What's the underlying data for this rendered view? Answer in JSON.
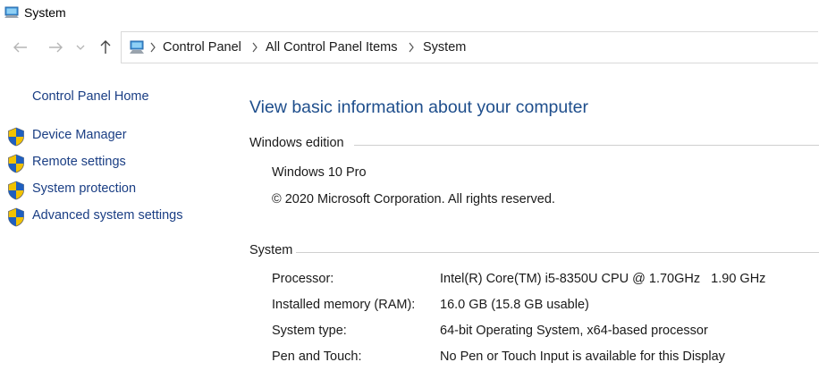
{
  "window": {
    "title": "System"
  },
  "nav": {
    "back": "back-arrow",
    "forward": "forward-arrow",
    "recent": "chevron-down",
    "up": "up-arrow"
  },
  "address": {
    "crumbs": [
      "Control Panel",
      "All Control Panel Items",
      "System"
    ]
  },
  "sidebar": {
    "home_label": "Control Panel Home",
    "tasks": [
      {
        "label": "Device Manager",
        "icon": "uac-shield-icon"
      },
      {
        "label": "Remote settings",
        "icon": "uac-shield-icon"
      },
      {
        "label": "System protection",
        "icon": "uac-shield-icon"
      },
      {
        "label": "Advanced system settings",
        "icon": "uac-shield-icon"
      }
    ]
  },
  "main": {
    "title": "View basic information about your computer",
    "edition": {
      "heading": "Windows edition",
      "name": "Windows 10 Pro",
      "copyright": "© 2020 Microsoft Corporation. All rights reserved."
    },
    "system": {
      "heading": "System",
      "rows": [
        {
          "label": "Processor:",
          "value": "Intel(R) Core(TM) i5-8350U CPU @ 1.70GHz   1.90 GHz"
        },
        {
          "label": "Installed memory (RAM):",
          "value": "16.0 GB (15.8 GB usable)"
        },
        {
          "label": "System type:",
          "value": "64-bit Operating System, x64-based processor"
        },
        {
          "label": "Pen and Touch:",
          "value": "No Pen or Touch Input is available for this Display"
        }
      ]
    }
  },
  "colors": {
    "link": "#1a3e84",
    "title": "#1e4e8c",
    "shield_blue": "#1f5fbf",
    "shield_yellow": "#f2c200"
  }
}
